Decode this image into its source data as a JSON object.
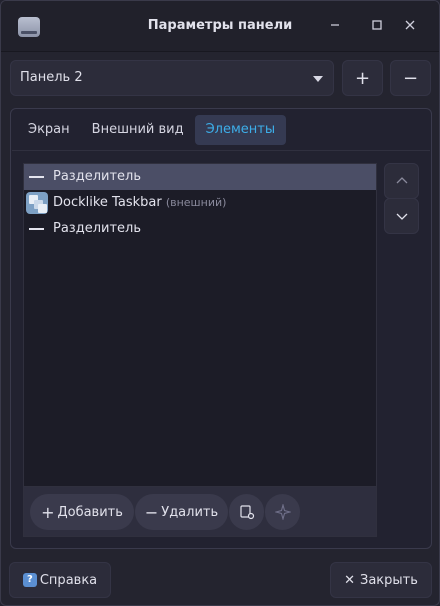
{
  "window": {
    "title": "Параметры панели"
  },
  "panel_selector": {
    "selected": "Панель 2"
  },
  "panel_buttons": {
    "add": "+",
    "remove": "−"
  },
  "tabs": [
    {
      "label": "Экран",
      "active": false
    },
    {
      "label": "Внешний вид",
      "active": false
    },
    {
      "label": "Элементы",
      "active": true
    }
  ],
  "items": [
    {
      "label": "Разделитель",
      "sublabel": "",
      "icon": "separator-dash-icon",
      "selected": true
    },
    {
      "label": "Docklike Taskbar",
      "sublabel": "(внешний)",
      "icon": "docklike-taskbar-icon",
      "selected": false
    },
    {
      "label": "Разделитель",
      "sublabel": "",
      "icon": "separator-dash-icon",
      "selected": false
    }
  ],
  "item_actions": {
    "add": "Добавить",
    "remove": "Удалить"
  },
  "footer": {
    "help": "Справка",
    "close": "Закрыть"
  },
  "colors": {
    "accent": "#3daee9",
    "window_bg": "#24242f",
    "selection": "#4b4e66"
  }
}
